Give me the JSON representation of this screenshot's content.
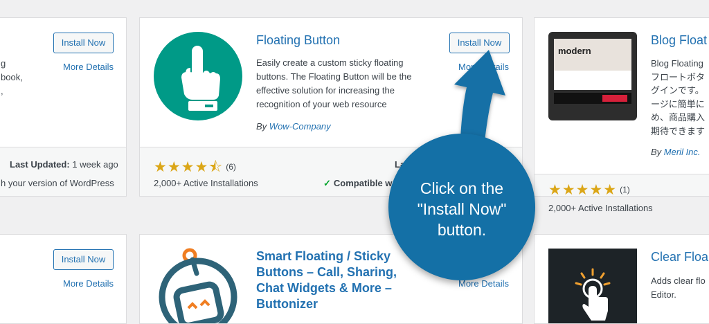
{
  "left_top": {
    "install_label": "Install Now",
    "more_details": "More Details",
    "desc_lines": [
      "g",
      "book,",
      ","
    ],
    "last_updated_label": "Last Updated:",
    "last_updated_value": "1 week ago",
    "compat_text": "h your version of WordPress"
  },
  "floating": {
    "title": "Floating Button",
    "install_label": "Install Now",
    "more_details": "More Details",
    "description": "Easily create a custom sticky floating buttons. The Floating Button will be the effective solution for increasing the recognition of your web resource",
    "by": "By",
    "author": "Wow-Company",
    "stars": "★★★★⯪",
    "rating_count": "(6)",
    "installs": "2,000+ Active Installations",
    "last_updated_partial": "La",
    "compat": "Compatible w",
    "rating": 4.5
  },
  "blog": {
    "title": "Blog Float",
    "thumb_text": "modern",
    "desc_lines": [
      "Blog Floating",
      "フロートボタ",
      "グインです。",
      "ージに簡単に",
      "め、商品購入",
      "期待できます"
    ],
    "by": "By",
    "author": "Meril Inc.",
    "stars": "★★★★★",
    "rating_count": "(1)",
    "installs": "2,000+ Active Installations",
    "rating": 5
  },
  "left_bottom": {
    "install_label": "Install Now",
    "more_details": "More Details"
  },
  "smart": {
    "title_lines": [
      "Smart Floating / Sticky",
      "Buttons – Call, Sharing,",
      "Chat Widgets & More –",
      "Buttonizer"
    ],
    "more_details": "More Details"
  },
  "clear": {
    "title": "Clear Floa",
    "desc_lines": [
      "Adds clear flo",
      "Editor."
    ]
  },
  "callout": {
    "lines": [
      "Click on the",
      "\"Install Now\"",
      "button."
    ]
  },
  "colors": {
    "accent": "#2271b1",
    "callout": "#1470a6",
    "star": "#dba617",
    "floating_icon_bg": "#009a87",
    "compatible_check": "#00a32a"
  }
}
